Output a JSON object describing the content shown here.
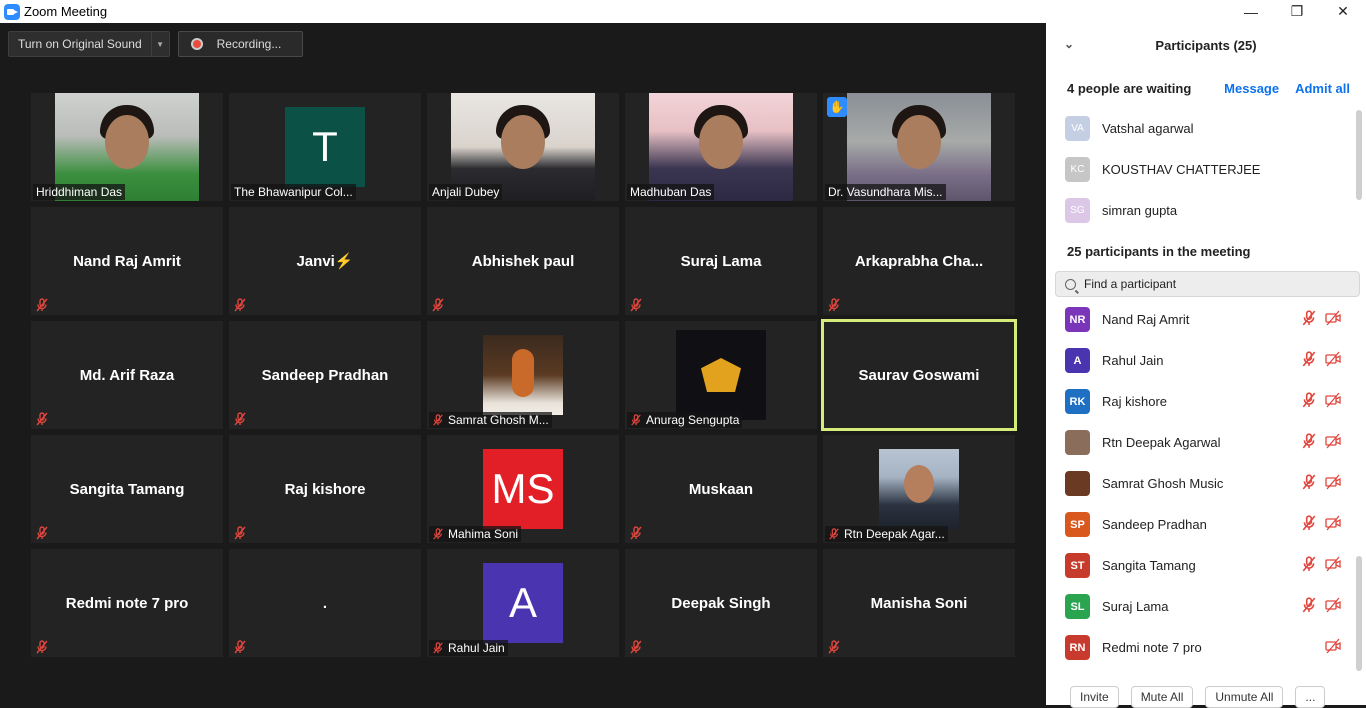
{
  "window": {
    "title": "Zoom Meeting",
    "minimize": "—",
    "restore": "❐",
    "close": "✕"
  },
  "toolbar": {
    "original_sound": "Turn on Original Sound",
    "recording": "Recording..."
  },
  "tiles": [
    {
      "kind": "video",
      "label": "Hriddhiman Das",
      "muted": false
    },
    {
      "kind": "avatar",
      "initial": "T",
      "color": "#0b5145",
      "label": "The Bhawanipur Col...",
      "muted": false
    },
    {
      "kind": "video",
      "label": "Anjali Dubey",
      "muted": false
    },
    {
      "kind": "video",
      "label": "Madhuban Das",
      "muted": false
    },
    {
      "kind": "video",
      "label": "Dr. Vasundhara Mis...",
      "muted": false,
      "hand": true
    },
    {
      "kind": "name",
      "name": "Nand Raj Amrit",
      "muted": true
    },
    {
      "kind": "name",
      "name": "Janvi⚡",
      "muted": true
    },
    {
      "kind": "name",
      "name": "Abhishek paul",
      "muted": true
    },
    {
      "kind": "name",
      "name": "Suraj Lama",
      "muted": true
    },
    {
      "kind": "name",
      "name": "Arkaprabha  Cha...",
      "muted": true
    },
    {
      "kind": "name",
      "name": "Md. Arif Raza",
      "muted": true
    },
    {
      "kind": "name",
      "name": "Sandeep Pradhan",
      "muted": true
    },
    {
      "kind": "image",
      "label": "Samrat Ghosh M...",
      "muted": true,
      "img": "guitar"
    },
    {
      "kind": "image",
      "label": "Anurag Sengupta",
      "muted": true,
      "img": "logo"
    },
    {
      "kind": "name",
      "name": "Saurav Goswami",
      "muted": false,
      "active": true
    },
    {
      "kind": "name",
      "name": "Sangita Tamang",
      "muted": true
    },
    {
      "kind": "name",
      "name": "Raj kishore",
      "muted": true
    },
    {
      "kind": "avatar",
      "initial": "MS",
      "color": "#e21f26",
      "label": "Mahima Soni",
      "muted": true
    },
    {
      "kind": "name",
      "name": "Muskaan",
      "muted": true
    },
    {
      "kind": "image",
      "label": "Rtn Deepak Agar...",
      "muted": true,
      "img": "portrait"
    },
    {
      "kind": "name",
      "name": "Redmi note 7 pro",
      "muted": true
    },
    {
      "kind": "name",
      "name": ".",
      "muted": true
    },
    {
      "kind": "avatar",
      "initial": "A",
      "color": "#4a34b0",
      "label": "Rahul Jain",
      "muted": true
    },
    {
      "kind": "name",
      "name": "Deepak Singh",
      "muted": true
    },
    {
      "kind": "name",
      "name": "Manisha Soni",
      "muted": true
    }
  ],
  "panel": {
    "title": "Participants (25)",
    "waiting_title": "4 people are waiting",
    "message": "Message",
    "admit_all": "Admit all",
    "waiting": [
      {
        "initials": "VA",
        "name": "Vatshal agarwal",
        "color": "#c5cfe4"
      },
      {
        "initials": "KC",
        "name": "KOUSTHAV CHATTERJEE",
        "color": "#c6c6c6"
      },
      {
        "initials": "SG",
        "name": "simran gupta",
        "color": "#dcc8e6"
      }
    ],
    "in_meeting_title": "25 participants in the meeting",
    "search_placeholder": "Find a participant",
    "participants": [
      {
        "initials": "NR",
        "name": "Nand Raj Amrit",
        "color": "#7b35b8",
        "mic": true
      },
      {
        "initials": "A",
        "name": "Rahul Jain",
        "color": "#4a34b0",
        "mic": true
      },
      {
        "initials": "RK",
        "name": "Raj kishore",
        "color": "#1f6fc2",
        "mic": true
      },
      {
        "initials": "",
        "name": "Rtn Deepak Agarwal",
        "color": "#8a6d5a",
        "mic": true
      },
      {
        "initials": "",
        "name": "Samrat Ghosh Music",
        "color": "#6b3a22",
        "mic": true
      },
      {
        "initials": "SP",
        "name": "Sandeep Pradhan",
        "color": "#d9581e",
        "mic": true
      },
      {
        "initials": "ST",
        "name": "Sangita Tamang",
        "color": "#c63b2c",
        "mic": true
      },
      {
        "initials": "SL",
        "name": "Suraj Lama",
        "color": "#2aa44f",
        "mic": true
      },
      {
        "initials": "RN",
        "name": "Redmi note 7 pro",
        "color": "#c93a2e",
        "mic": false
      }
    ],
    "footer": {
      "invite": "Invite",
      "mute_all": "Mute All",
      "unmute_all": "Unmute All",
      "more": "..."
    }
  }
}
